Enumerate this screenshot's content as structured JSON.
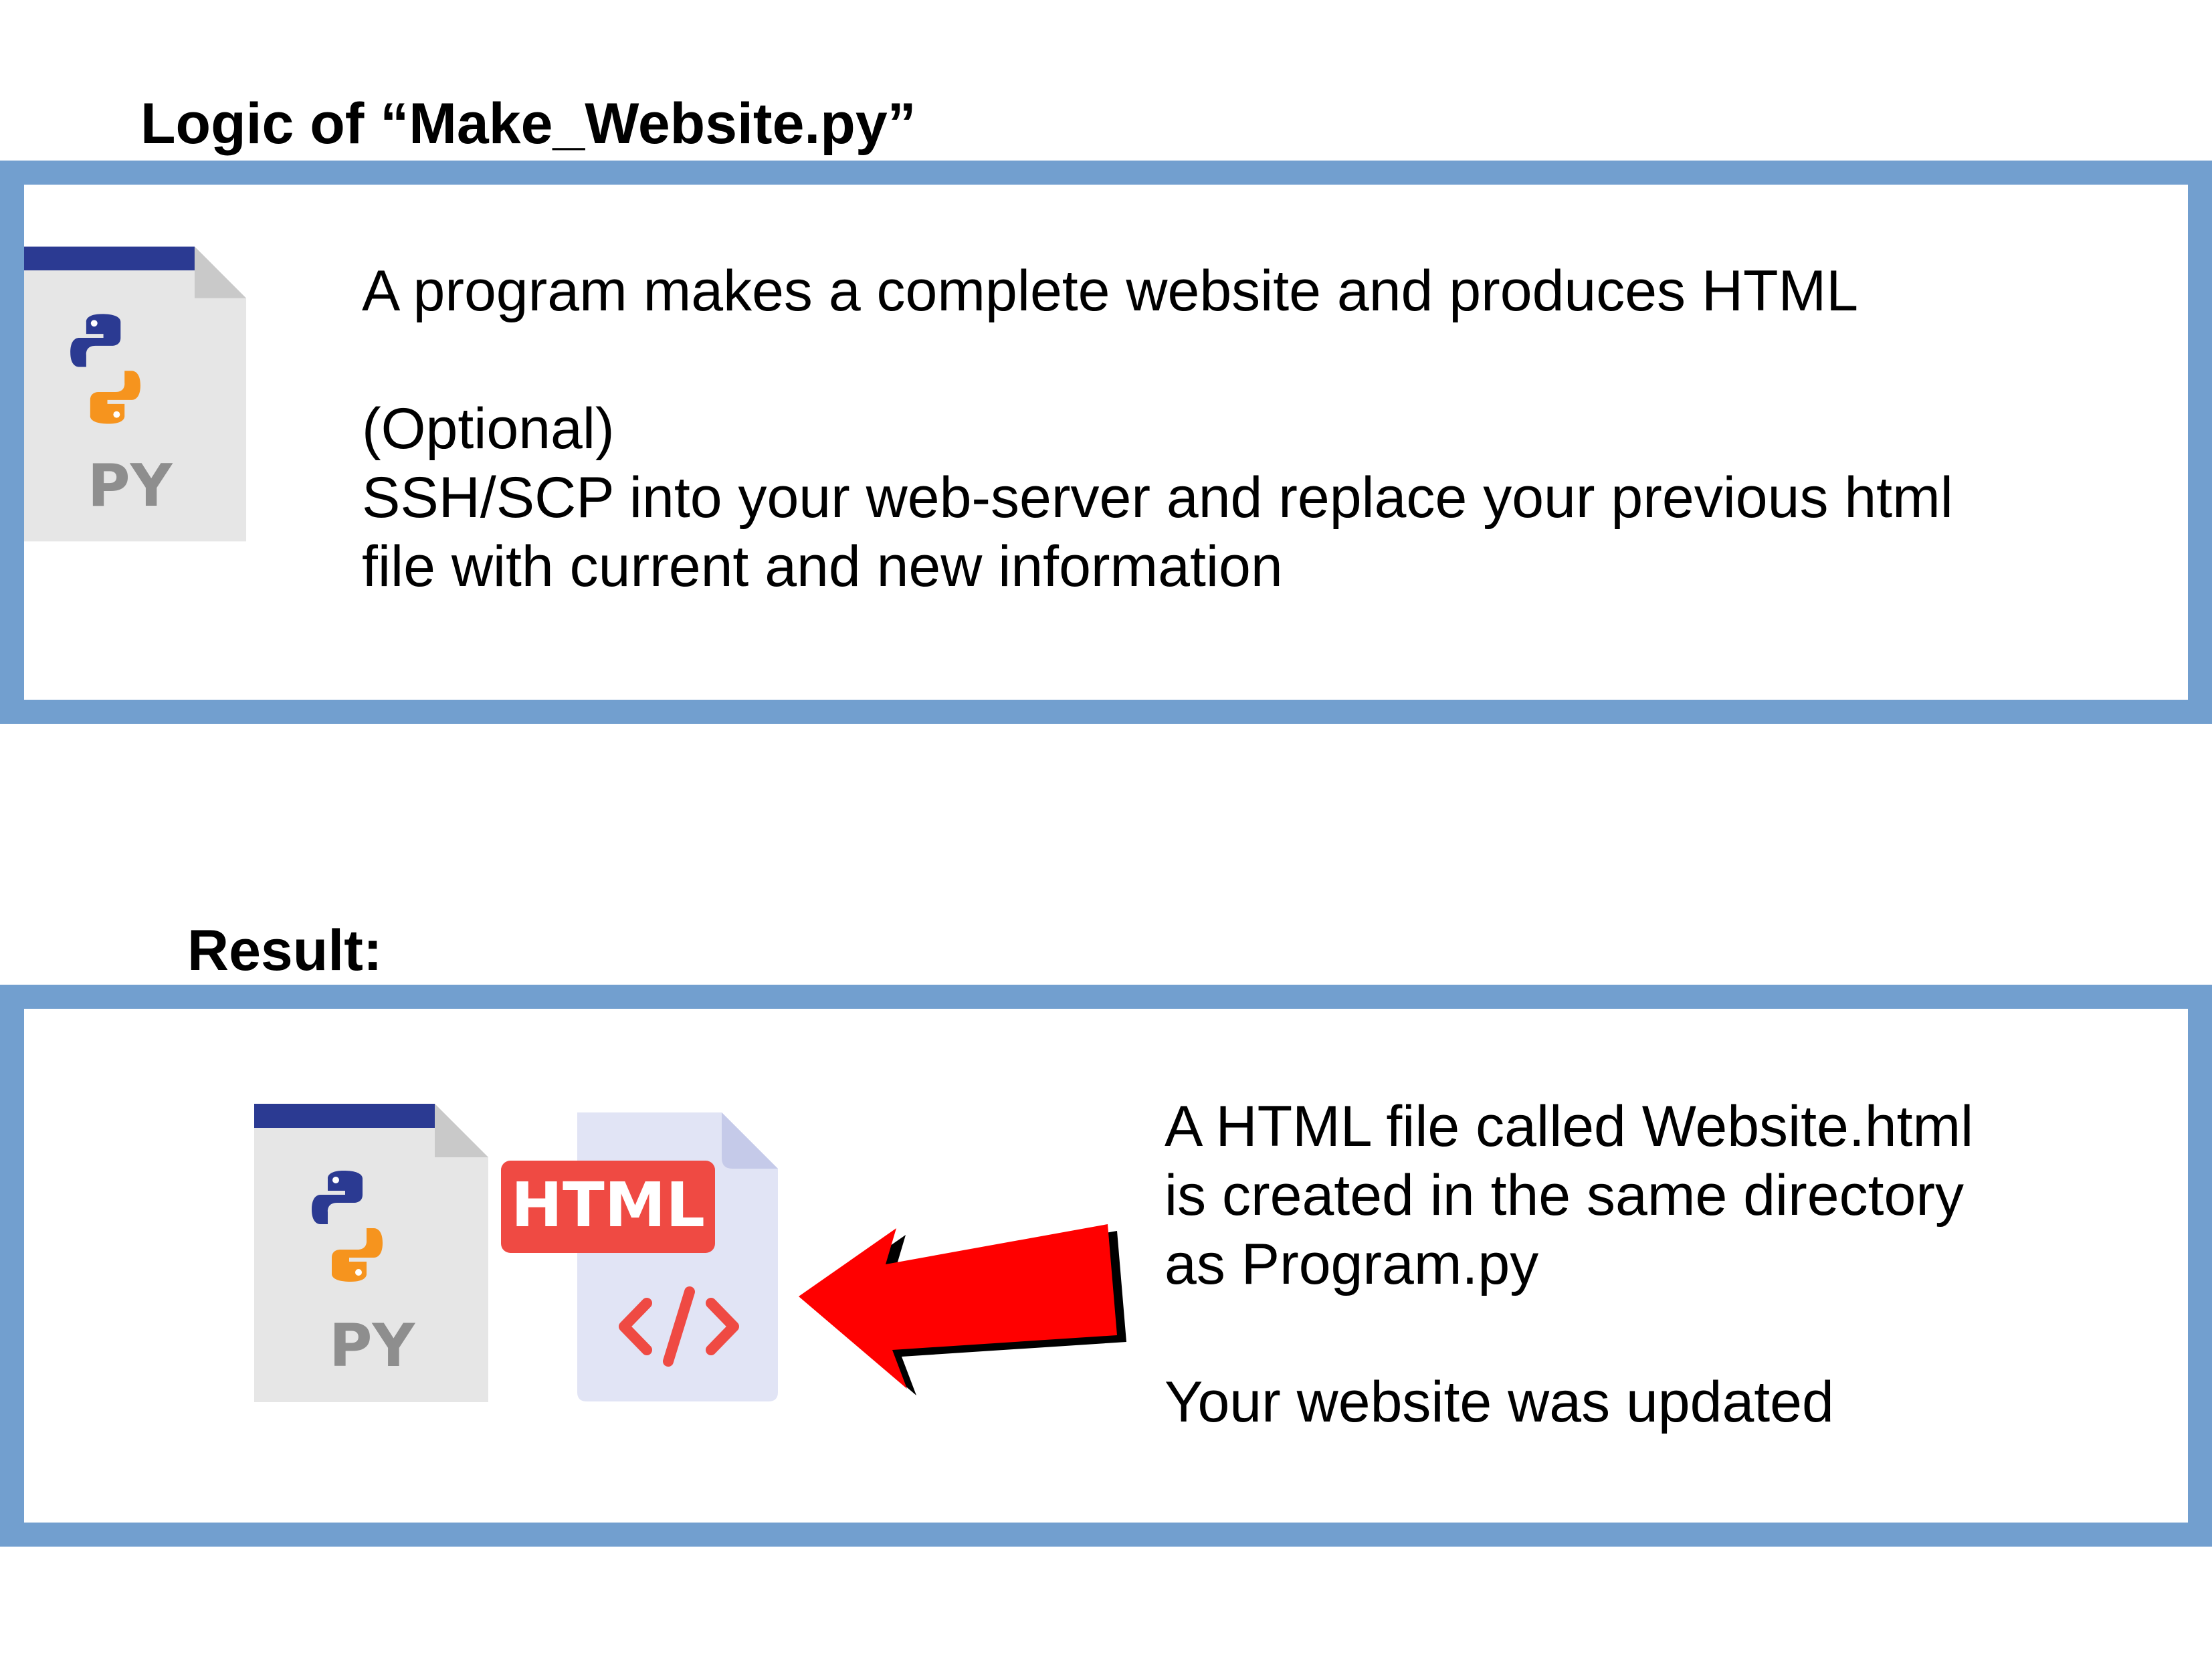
{
  "logic_section": {
    "heading": "Logic of “Make_Website.py”",
    "icon": "python-file-icon",
    "icon_label": "PY",
    "lines": [
      "A program makes a complete website and produces HTML",
      "",
      "(Optional)",
      "SSH/SCP into your web-server and replace your previous html",
      "file with current and new information"
    ]
  },
  "result_section": {
    "heading": "Result:",
    "python_icon": "python-file-icon",
    "python_icon_label": "PY",
    "html_icon": "html-file-icon",
    "html_icon_label": "HTML",
    "arrow_icon": "red-arrow-icon",
    "lines": [
      "A HTML file called Website.html",
      "is created in the same directory",
      "as Program.py",
      "",
      "Your website was updated"
    ]
  },
  "colors": {
    "panel_border": "#729fcf",
    "python_blue": "#2b3a92",
    "python_yellow": "#f6941e",
    "file_gray": "#e6e6e6",
    "html_red": "#ef4a43",
    "html_file_bg": "#e1e4f5",
    "arrow_red": "#ff0000"
  }
}
